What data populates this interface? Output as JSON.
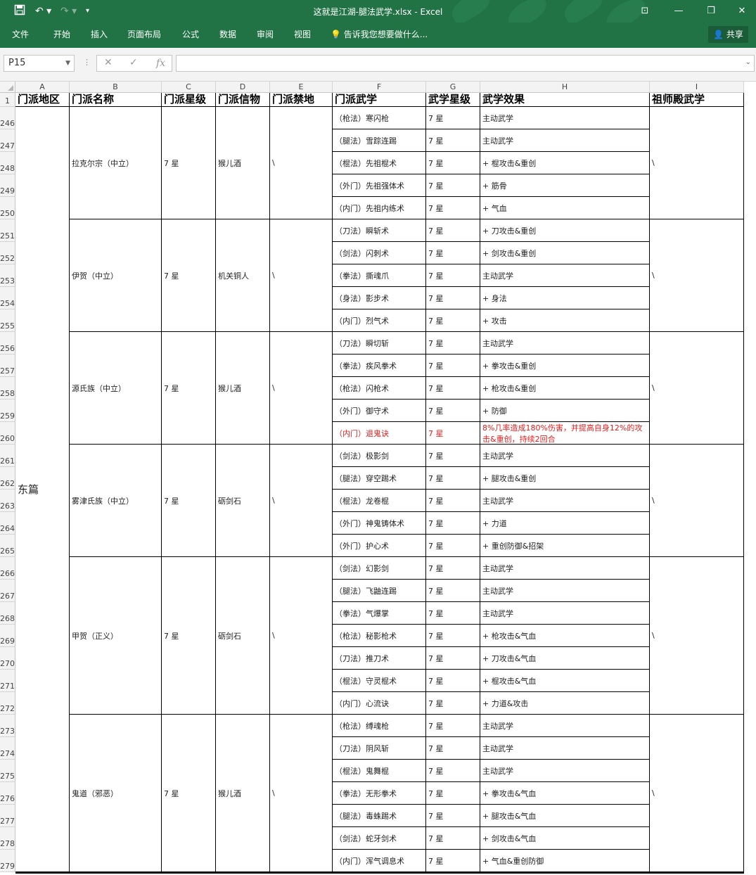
{
  "window": {
    "title": "这就是江湖-腿法武学.xlsx - Excel",
    "colors": {
      "excel_green": "#217346",
      "red_text": "#e02020"
    }
  },
  "quick_access": {
    "save_icon": "save-icon",
    "undo_icon": "undo-icon",
    "redo_icon": "redo-icon",
    "customize_icon": "chevron-down-icon"
  },
  "ribbon": {
    "tabs": [
      "文件",
      "开始",
      "插入",
      "页面布局",
      "公式",
      "数据",
      "审阅",
      "视图"
    ],
    "tell_me": "告诉我您想要做什么...",
    "share": "共享"
  },
  "formula_bar": {
    "name_box": "P15",
    "formula": ""
  },
  "columns": [
    "A",
    "B",
    "C",
    "D",
    "E",
    "F",
    "G",
    "H",
    "I"
  ],
  "header_row": {
    "row": "1",
    "cells": [
      "门派地区",
      "门派名称",
      "门派星级",
      "门派信物",
      "门派禁地",
      "门派武学",
      "武学星级",
      "武学效果",
      "祖师殿武学"
    ]
  },
  "region": "东篇",
  "sects": [
    {
      "name": "拉克尔宗（中立）",
      "star": "7 星",
      "token": "猴儿酒",
      "forbidden": "\\",
      "hall": "\\",
      "skills": [
        [
          "（枪法）寒闪枪",
          "7 星",
          "主动武学"
        ],
        [
          "（腿法）雪踪连踢",
          "7 星",
          "主动武学"
        ],
        [
          "（棍法）先祖棍术",
          "7 星",
          "+ 棍攻击&重创"
        ],
        [
          "（外门）先祖强体术",
          "7 星",
          "+ 筋骨"
        ],
        [
          "（内门）先祖内练术",
          "7 星",
          "+ 气血"
        ]
      ]
    },
    {
      "name": "伊贺（中立）",
      "star": "7 星",
      "token": "机关铜人",
      "forbidden": "\\",
      "hall": "\\",
      "skills": [
        [
          "（刀法）瞬斩术",
          "7 星",
          "+ 刀攻击&重创"
        ],
        [
          "（剑法）闪刺术",
          "7 星",
          "+ 剑攻击&重创"
        ],
        [
          "（拳法）撕魂爪",
          "7 星",
          "主动武学"
        ],
        [
          "（身法）影步术",
          "7 星",
          "+ 身法"
        ],
        [
          "（内门）烈气术",
          "7 星",
          "+ 攻击"
        ]
      ]
    },
    {
      "name": "源氏族（中立）",
      "star": "7 星",
      "token": "猴儿酒",
      "forbidden": "\\",
      "hall": "\\",
      "skills": [
        [
          "（刀法）瞬切斩",
          "7 星",
          "主动武学"
        ],
        [
          "（拳法）疾风拳术",
          "7 星",
          "+ 拳攻击&重创"
        ],
        [
          "（枪法）闪枪术",
          "7 星",
          "+ 枪攻击&重创"
        ],
        [
          "（外门）御守术",
          "7 星",
          "+ 防御"
        ],
        [
          "（内门）退鬼诀",
          "7 星",
          "8%几率造成180%伤害，并提高自身12%的攻击&重创，持续2回合"
        ]
      ]
    },
    {
      "name": "雾津氏族（中立）",
      "star": "7 星",
      "token": "砺剑石",
      "forbidden": "\\",
      "hall": "\\",
      "skills": [
        [
          "（剑法）极影剑",
          "7 星",
          "主动武学"
        ],
        [
          "（腿法）穿空踢术",
          "7 星",
          "+ 腿攻击&重创"
        ],
        [
          "（棍法）龙卷棍",
          "7 星",
          "主动武学"
        ],
        [
          "（外门）神鬼铸体术",
          "7 星",
          "+ 力道"
        ],
        [
          "（外门）护心术",
          "7 星",
          "+ 重创防御&招架"
        ]
      ]
    },
    {
      "name": "甲贺（正义）",
      "star": "7 星",
      "token": "砺剑石",
      "forbidden": "\\",
      "hall": "\\",
      "skills": [
        [
          "（剑法）幻影剑",
          "7 星",
          "主动武学"
        ],
        [
          "（腿法）飞鼬连踢",
          "7 星",
          "主动武学"
        ],
        [
          "（拳法）气爆掌",
          "7 星",
          "主动武学"
        ],
        [
          "（枪法）秘影枪术",
          "7 星",
          "+ 枪攻击&气血"
        ],
        [
          "（刀法）推刀术",
          "7 星",
          "+ 刀攻击&气血"
        ],
        [
          "（棍法）守灵棍术",
          "7 星",
          "+ 棍攻击&气血"
        ],
        [
          "（内门）心流诀",
          "7 星",
          "+ 力道&攻击"
        ]
      ]
    },
    {
      "name": "鬼道（邪恶）",
      "star": "7 星",
      "token": "猴儿酒",
      "forbidden": "\\",
      "hall": "\\",
      "skills": [
        [
          "（枪法）缚魂枪",
          "7 星",
          "主动武学"
        ],
        [
          "（刀法）阴风斩",
          "7 星",
          "主动武学"
        ],
        [
          "（棍法）鬼舞棍",
          "7 星",
          "主动武学"
        ],
        [
          "（拳法）无形拳术",
          "7 星",
          "+ 拳攻击&气血"
        ],
        [
          "（腿法）毒蛛踢术",
          "7 星",
          "+ 腿攻击&气血"
        ],
        [
          "（剑法）蛇牙剑术",
          "7 星",
          "+ 剑攻击&气血"
        ],
        [
          "（内门）浑气调息术",
          "7 星",
          "+ 气血&重创防御"
        ]
      ]
    }
  ],
  "red_skill": "（内门）退鬼诀",
  "first_row_number": 246
}
